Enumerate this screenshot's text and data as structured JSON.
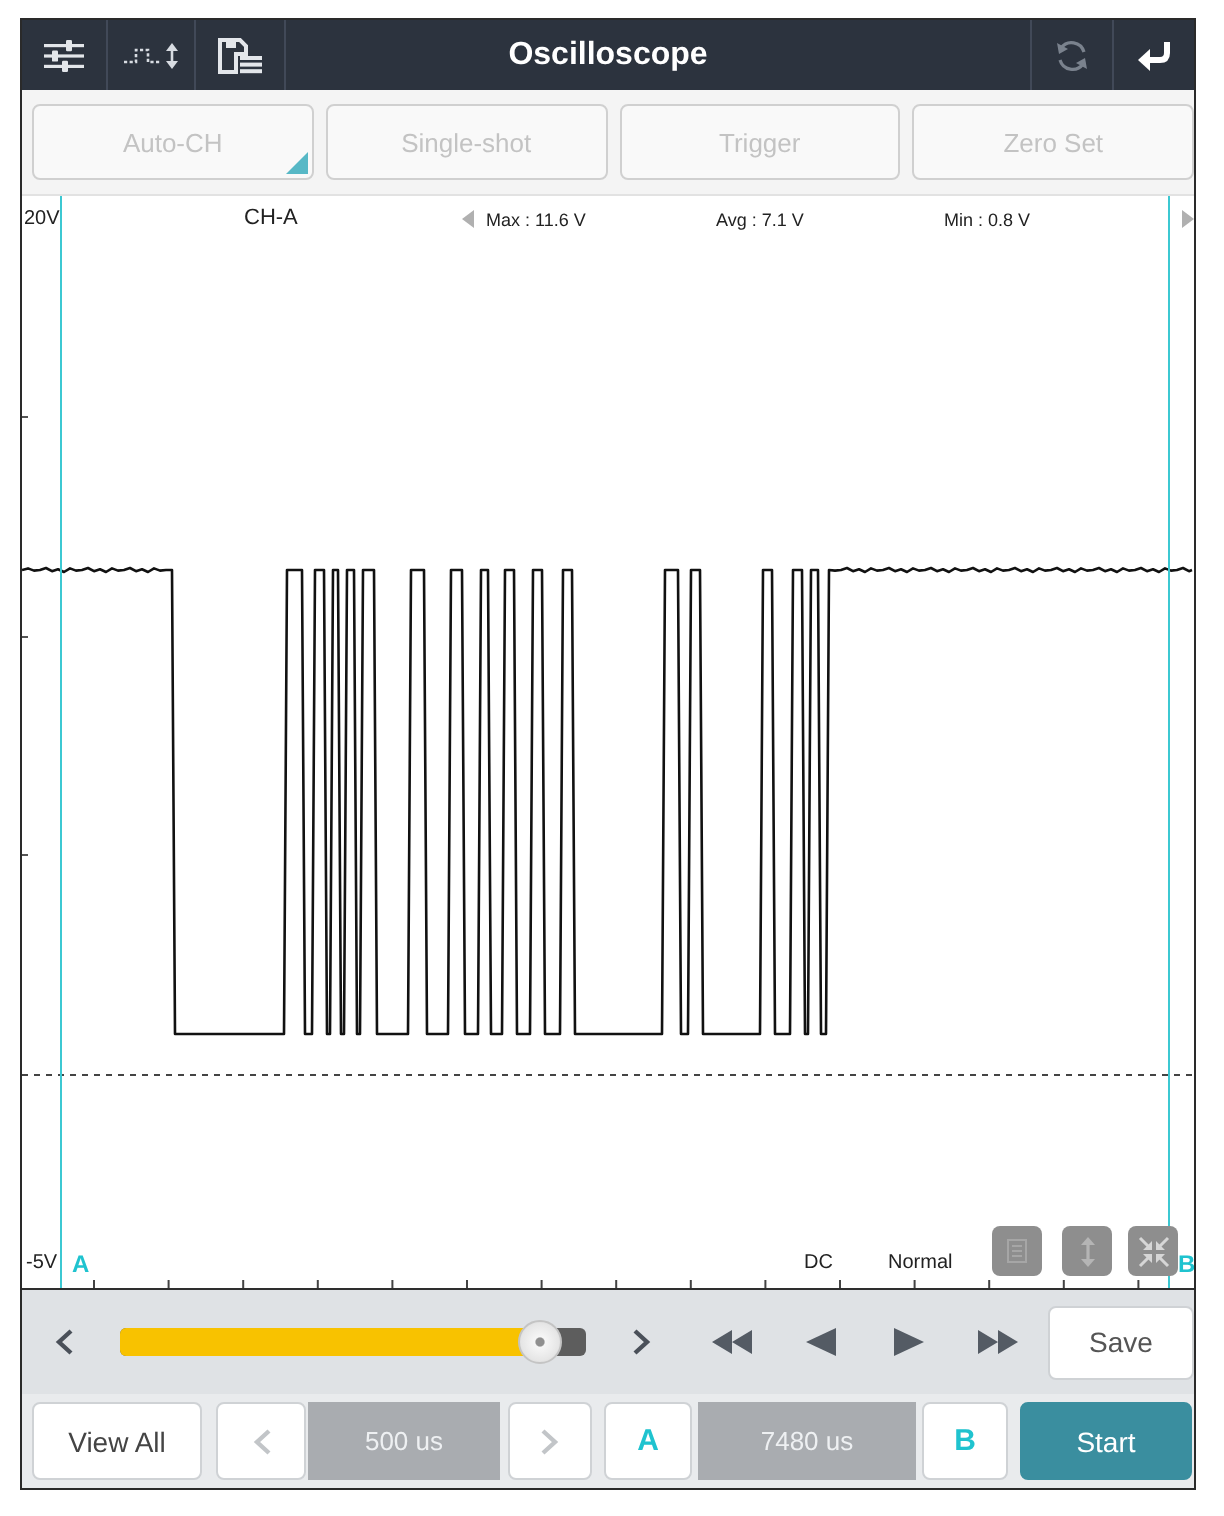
{
  "top_bar": {
    "title": "Oscilloscope"
  },
  "mode_buttons": [
    {
      "label": "Auto-CH",
      "disabled": true,
      "dropdown": true
    },
    {
      "label": "Single-shot",
      "disabled": true,
      "dropdown": false
    },
    {
      "label": "Trigger",
      "disabled": true,
      "dropdown": false
    },
    {
      "label": "Zero Set",
      "disabled": true,
      "dropdown": false
    }
  ],
  "scope": {
    "scale_top": "20V",
    "channel": "CH-A",
    "readings": [
      "Max : 11.6 V",
      "Avg : 7.1 V",
      "Min : 0.8 V"
    ],
    "scale_bottom": "-5V",
    "cursor_a": "A",
    "coupling": "DC",
    "trigger_mode": "Normal",
    "cursor_b": "B"
  },
  "timeline": {
    "level": 0.9
  },
  "save_button": "Save",
  "bottom_bar": {
    "view_all": "View All",
    "timebase": "500 us",
    "cursor_a": "A",
    "cursor_span": "7480 us",
    "cursor_b": "B",
    "start": "Start"
  }
}
